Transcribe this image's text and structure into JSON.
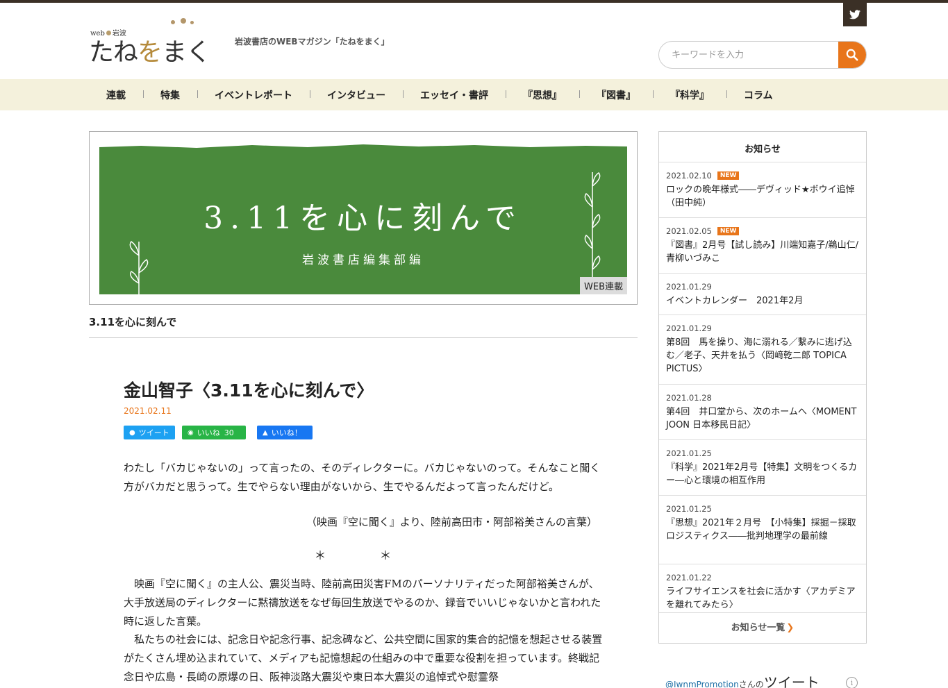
{
  "site": {
    "logo_small": "web",
    "logo_small2": "岩波",
    "logo_main_1": "たね",
    "logo_main_wo": "を",
    "logo_main_2": "まく",
    "tagline": "岩波書店のWEBマガジン「たねをまく」"
  },
  "search": {
    "placeholder": "キーワードを入力"
  },
  "nav": {
    "items": [
      "連載",
      "特集",
      "イベントレポート",
      "インタビュー",
      "エッセイ・書評",
      "『思想』",
      "『図書』",
      "『科学』",
      "コラム"
    ]
  },
  "banner": {
    "title": "3.11を心に刻んで",
    "subtitle": "岩波書店編集部編",
    "badge": "WEB連載"
  },
  "series_title": "3.11を心に刻んで",
  "article": {
    "title": "金山智子〈3.11を心に刻んで〉",
    "date": "2021.02.11",
    "share": {
      "tweet": "ツイート",
      "line": "いいね",
      "line_count": "30",
      "fb": "いいね！"
    },
    "p1": "わたし「バカじゃないの」って言ったの、そのディレクターに。バカじゃないのって。そんなこと聞く方がバカだと思うって。生でやらない理由がないから、生でやるんだよって言ったんだけど。",
    "cite": "（映画『空に聞く』より、陸前高田市・阿部裕美さんの言葉）",
    "stars": "＊　＊",
    "p2": "　映画『空に聞く』の主人公、震災当時、陸前高田災害FMのパーソナリティだった阿部裕美さんが、大手放送局のディレクターに黙禱放送をなぜ毎回生放送でやるのか、録音でいいじゃないかと言われた時に返した言葉。",
    "p3": "　私たちの社会には、記念日や記念行事、記念碑など、公共空間に国家的集合的記憶を想起させる装置がたくさん埋め込まれていて、メディアも記憶想起の仕組みの中で重要な役割を担っています。終戦記念日や広島・長崎の原爆の日、阪神淡路大震災や東日本大震災の追悼式や慰霊祭"
  },
  "news": {
    "heading": "お知らせ",
    "new_label": "NEW",
    "items": [
      {
        "date": "2021.02.10",
        "is_new": true,
        "title": "ロックの晩年様式――デヴィッド★ボウイ追悼（田中純）"
      },
      {
        "date": "2021.02.05",
        "is_new": true,
        "title": "『図書』2月号【試し読み】川端知嘉子/鵜山仁/青柳いづみこ"
      },
      {
        "date": "2021.01.29",
        "is_new": false,
        "title": "イベントカレンダー　2021年2月"
      },
      {
        "date": "2021.01.29",
        "is_new": false,
        "title": "第8回　馬を操り、海に溺れる／繋みに逃げ込む／老子、天井を払う〈岡﨑乾二郎 TOPICA PICTUS〉"
      },
      {
        "date": "2021.01.28",
        "is_new": false,
        "title": "第4回　井口堂から、次のホームへ〈MOMENT JOON 日本移民日記〉"
      },
      {
        "date": "2021.01.25",
        "is_new": false,
        "title": "『科学』2021年2月号【特集】文明をつくるカー―心と環境の相互作用"
      },
      {
        "date": "2021.01.25",
        "is_new": false,
        "title": "『思想』2021年２月号　【小特集】採掘－採取ロジスティクス――批判地理学の最前線"
      },
      {
        "date": "2021.01.22",
        "is_new": false,
        "title": "ライフサイエンスを社会に活かす〈アカデミアを離れてみたら〉"
      }
    ],
    "more": "お知らせ一覧"
  },
  "twitter_feed": {
    "account": "@IwnmPromotion",
    "suffix": "さんの",
    "label": "ツイート"
  },
  "colors": {
    "accent": "#e8751a",
    "nav_bg": "#f4f1dc",
    "banner_green": "#4a8a3c",
    "dark": "#3b3026"
  }
}
